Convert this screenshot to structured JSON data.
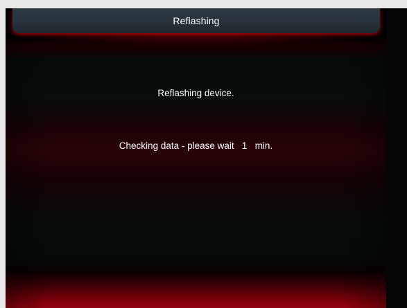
{
  "header": {
    "title": "Reflashing"
  },
  "main": {
    "status_message": "Reflashing device.",
    "wait_prefix": "Checking data - please wait",
    "wait_value": "1",
    "wait_unit": "min."
  },
  "colors": {
    "header_bg": "#26313a",
    "accent_red": "#c8000f",
    "background": "#070b0b",
    "text": "#ffffff"
  }
}
